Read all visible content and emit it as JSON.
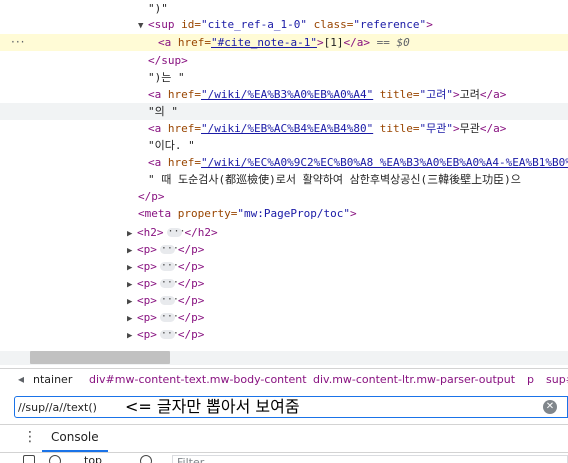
{
  "elements": {
    "lines": [
      {
        "id": "l0",
        "text": "\")\""
      },
      {
        "id": "l1",
        "open": "<sup",
        "a1n": " id=",
        "a1v": "\"cite_ref-a_1-0\"",
        "a2n": " class=",
        "a2v": "\"reference\"",
        "close": ">"
      },
      {
        "id": "l2",
        "open": "<a",
        "a1n": " href=",
        "a1v": "\"#cite_note-a-1\"",
        "close": ">",
        "text": "[1]",
        "end": "</a>",
        "eq": " == $0"
      },
      {
        "id": "l3",
        "end": "</sup>"
      },
      {
        "id": "l4",
        "text": "\")는 \""
      },
      {
        "id": "l5",
        "open": "<a",
        "a1n": " href=",
        "a1v": "\"/wiki/%EA%B3%A0%EB%A0%A4\"",
        "a2n": " title=",
        "a2v": "\"고려\"",
        "close": ">",
        "text": "고려",
        "end": "</a>"
      },
      {
        "id": "l6",
        "text": "\"의 \""
      },
      {
        "id": "l7",
        "open": "<a",
        "a1n": " href=",
        "a1v": "\"/wiki/%EB%AC%B4%EA%B4%80\"",
        "a2n": " title=",
        "a2v": "\"무관\"",
        "close": ">",
        "text": "무관",
        "end": "</a>"
      },
      {
        "id": "l8",
        "text": "\"이다. \""
      },
      {
        "id": "l9",
        "open": "<a",
        "a1n": " href=",
        "a1v": "\"/wiki/%EC%A0%9C2%EC%B0%A8 %EA%B3%A0%EB%A0%A4-%EA%B1%B0%"
      },
      {
        "id": "l10",
        "text": "\" 때 도순검사(都巡檢使)로서 활약하여 삼한후벽상공신(三韓後壁上功臣)으"
      },
      {
        "id": "l11",
        "end": "</p>"
      },
      {
        "id": "l12",
        "open": "<meta",
        "a1n": " property=",
        "a1v": "\"mw:PageProp/toc\"",
        "close": ">"
      },
      {
        "id": "l13",
        "open": "<h2>",
        "end": "</h2>"
      },
      {
        "id": "l14",
        "open": "<p>",
        "end": "</p>"
      },
      {
        "id": "l15",
        "open": "<p>",
        "end": "</p>"
      },
      {
        "id": "l16",
        "open": "<p>",
        "end": "</p>"
      },
      {
        "id": "l17",
        "open": "<p>",
        "end": "</p>"
      },
      {
        "id": "l18",
        "open": "<p>",
        "end": "</p>"
      },
      {
        "id": "l19",
        "open": "<p>",
        "end": "</p>"
      }
    ],
    "gutter_dots": "···"
  },
  "breadcrumbs": {
    "items": [
      "ntainer",
      "div#mw-content-text.mw-body-content",
      "div.mw-content-ltr.mw-parser-output",
      "p",
      "sup#"
    ]
  },
  "search": {
    "value": "//sup//a//text()",
    "note": "<= 글자만 뽑아서 보여줌"
  },
  "drawer": {
    "console_tab": "Console",
    "context": "top",
    "filter_placeholder": "Filter"
  },
  "colors": {
    "tag": "#881280",
    "attr_name": "#994500",
    "attr_value": "#1a1aa6",
    "highlight": "#fffbd6",
    "focus": "#1a73e8"
  }
}
